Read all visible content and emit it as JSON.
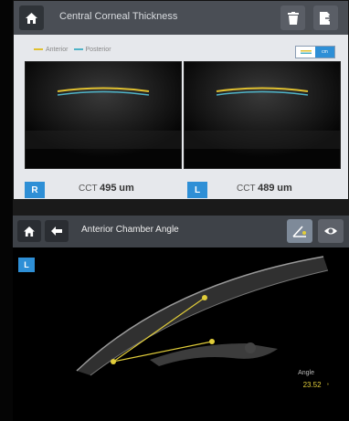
{
  "cct_panel": {
    "title": "Central Corneal Thickness",
    "legend": {
      "anterior": "Anterior",
      "posterior": "Posterior",
      "anterior_color": "#e0c030",
      "posterior_color": "#4fb3c7"
    },
    "toggle": {
      "left": "",
      "right": "cm"
    },
    "right_eye": {
      "badge": "R",
      "label": "CCT",
      "value": "495",
      "unit": "um"
    },
    "left_eye": {
      "badge": "L",
      "label": "CCT",
      "value": "489",
      "unit": "um"
    }
  },
  "angle_panel": {
    "title": "Anterior Chamber Angle",
    "eye_badge": "L",
    "angle_label": "Angle",
    "angle_value": "23.52",
    "angle_unit": "°"
  },
  "colors": {
    "accent": "#2e8fd6",
    "measure_line": "#e1cd3a"
  }
}
